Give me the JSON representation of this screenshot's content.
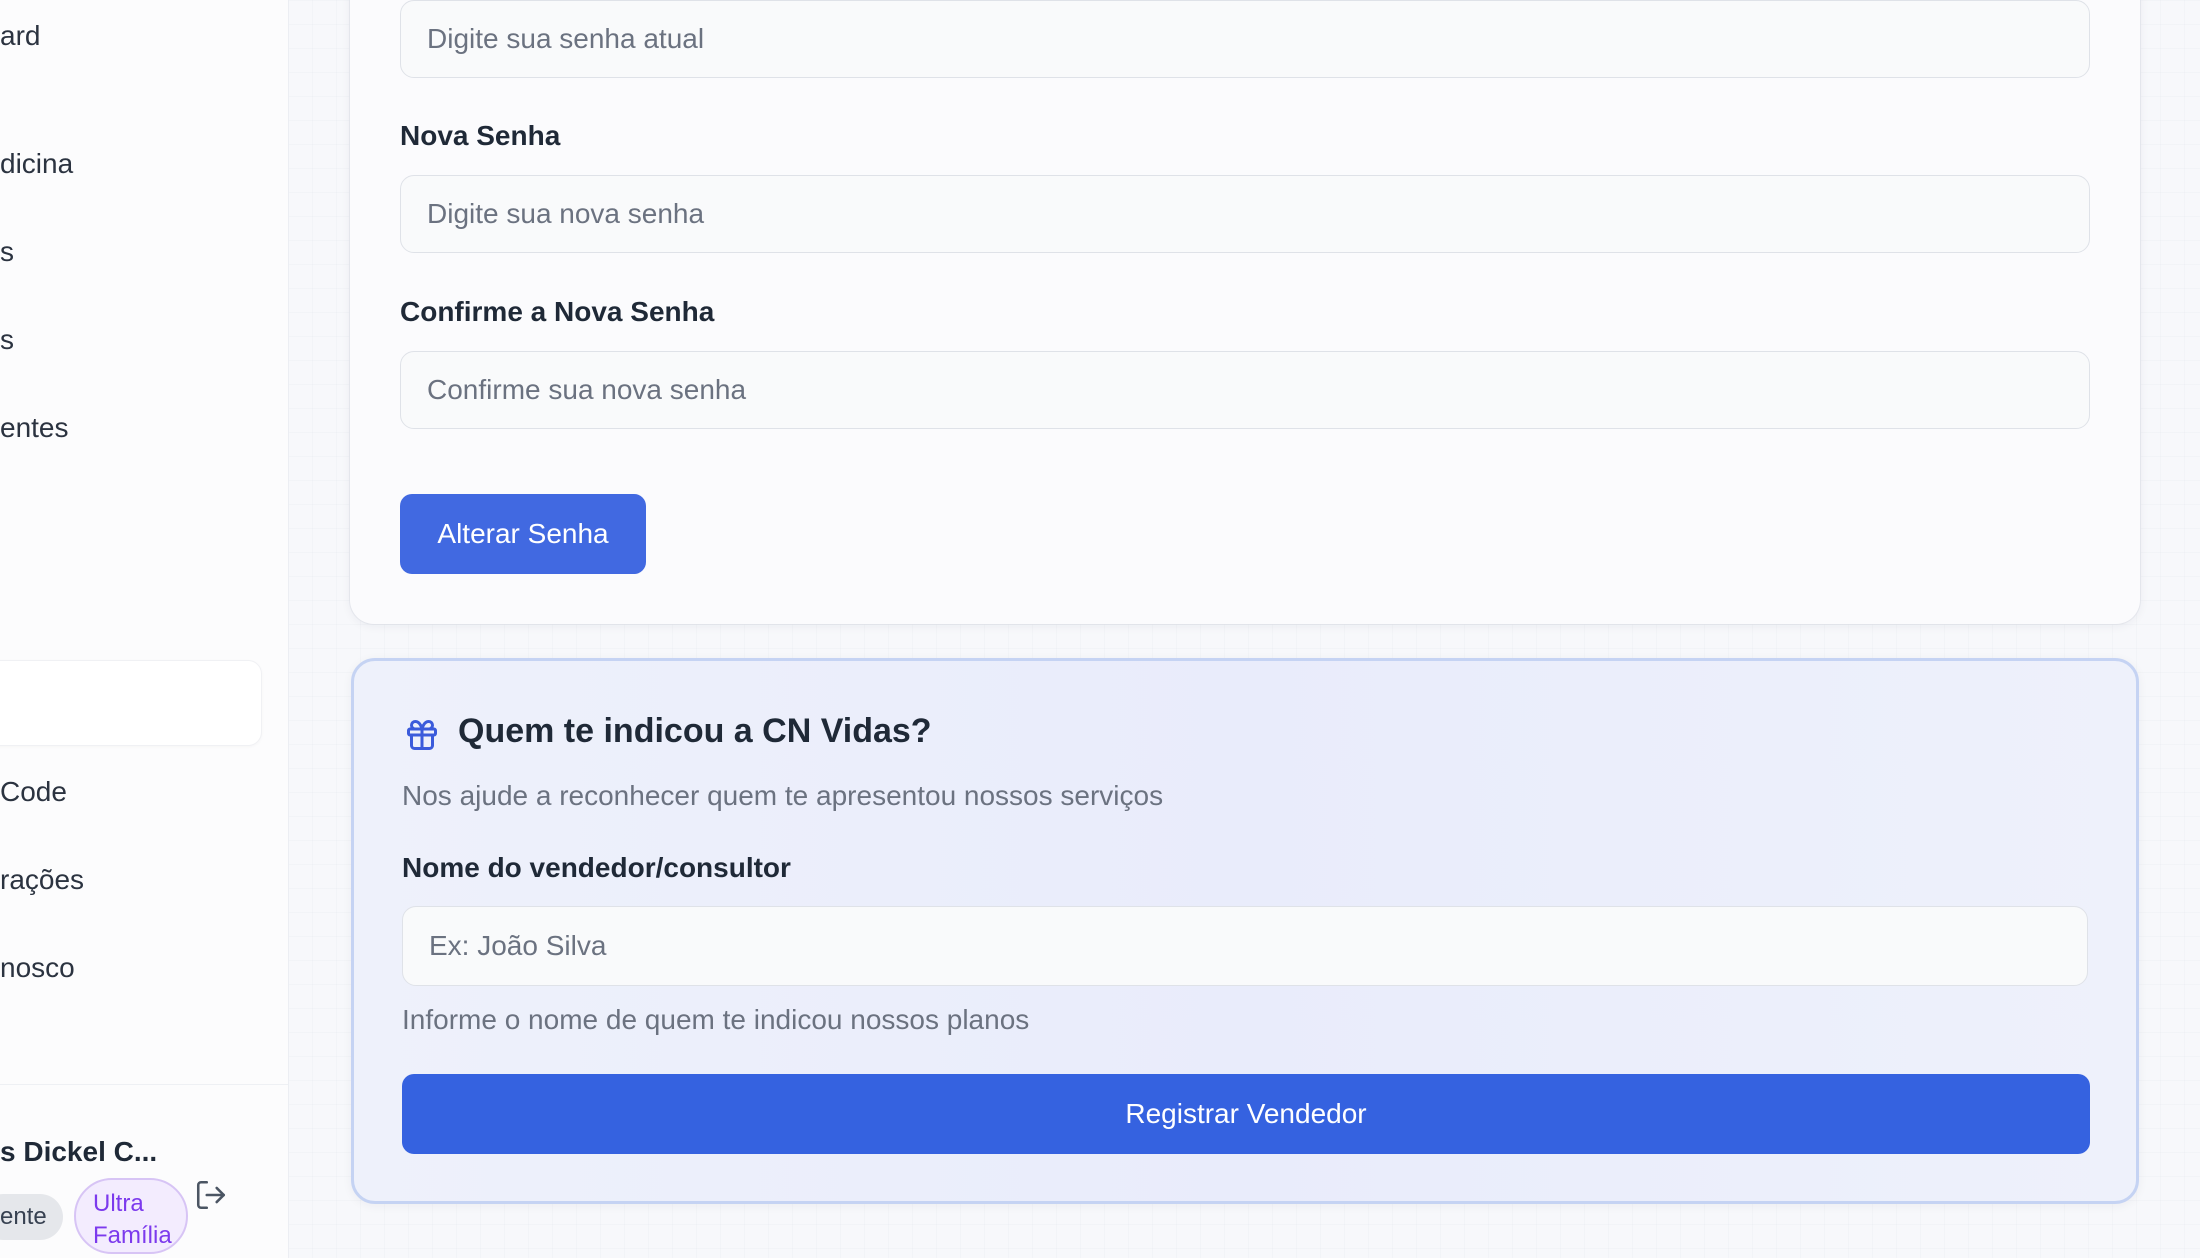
{
  "sidebar": {
    "items": [
      {
        "label": "ard"
      },
      {
        "label": "dicina"
      },
      {
        "label": "s"
      },
      {
        "label": "s"
      },
      {
        "label": "entes"
      }
    ],
    "bottom_items": [
      {
        "label": " Code"
      },
      {
        "label": "rações"
      },
      {
        "label": "nosco"
      }
    ],
    "user": {
      "name": "s Dickel C...",
      "role": "ente",
      "plan_line1": "Ultra",
      "plan_line2": "Família"
    }
  },
  "password_card": {
    "current_placeholder": "Digite sua senha atual",
    "new_label": "Nova Senha",
    "new_placeholder": "Digite sua nova senha",
    "confirm_label": "Confirme a Nova Senha",
    "confirm_placeholder": "Confirme sua nova senha",
    "submit_label": "Alterar Senha"
  },
  "referral_card": {
    "title": "Quem te indicou a CN Vidas?",
    "subtitle": "Nos ajude a reconhecer quem te apresentou nossos serviços",
    "field_label": "Nome do vendedor/consultor",
    "field_placeholder": "Ex: João Silva",
    "helper_text": "Informe o nome de quem te indicou nossos planos",
    "submit_label": "Registrar Vendedor"
  },
  "colors": {
    "primary": "#4169e1",
    "primary_dark": "#3562e0",
    "plan_purple": "#7c3aed"
  },
  "icons": {
    "gift": "gift-icon",
    "logout": "logout-icon"
  }
}
